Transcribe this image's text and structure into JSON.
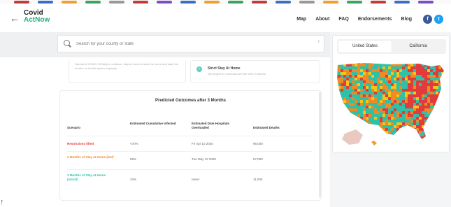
{
  "brand": {
    "logo_line1": "Covid",
    "logo_line2": "ActNow"
  },
  "nav": {
    "back_icon": "back-arrow-icon",
    "links": [
      "Map",
      "About",
      "FAQ",
      "Endorsements",
      "Blog"
    ],
    "social": {
      "facebook": "f",
      "twitter": "t"
    }
  },
  "search": {
    "placeholder": "Search for your county or state",
    "arrow_icon": "chevron-right-icon"
  },
  "cards": {
    "left_text": "Spread of COVID-19 likely to continue; stay at home to slow the curve and ease the burden on health system capacity.",
    "right_title": "Strict Stay At Home",
    "right_subtitle": "We project no overload over the next 3 months"
  },
  "outcomes": {
    "title": "Predicted Outcomes after 3 Months",
    "columns": [
      "Scenario",
      "Estimated Cumulative Infected",
      "Estimated Date Hospitals Overloaded",
      "Estimated Deaths"
    ],
    "rows": [
      {
        "scenario": "Restrictions lifted",
        "color": "#e23b3b",
        "infected": "<70%",
        "date": "Fri Apr 10 2020",
        "deaths": "96,000"
      },
      {
        "scenario": "3 Months of Stay at Home (lax)*",
        "color": "#f08a24",
        "infected": "58%",
        "date": "Tue May 12 2020",
        "deaths": "57,000"
      },
      {
        "scenario": "3 Months of Stay at Home (strict)*",
        "color": "#2fc1a7",
        "infected": "10%",
        "date": "never",
        "deaths": "11,000"
      }
    ]
  },
  "map": {
    "tabs": [
      "United States",
      "California"
    ],
    "active_tab": "United States",
    "colors": {
      "critical": "#e23b3b",
      "high": "#f08a24",
      "medium": "#f5c518",
      "low": "#2fc1a7"
    }
  },
  "bookmarks": [
    "#c23b3b",
    "#3b6fc2",
    "#f0a030",
    "#3aa55c",
    "#999",
    "#c23b3b",
    "#7a50c2",
    "#3b6fc2",
    "#f0a030",
    "#3aa55c",
    "#c23b3b",
    "#3b6fc2",
    "#999",
    "#f0a030",
    "#3aa55c",
    "#c23b3b",
    "#3b6fc2",
    "#7a50c2"
  ]
}
